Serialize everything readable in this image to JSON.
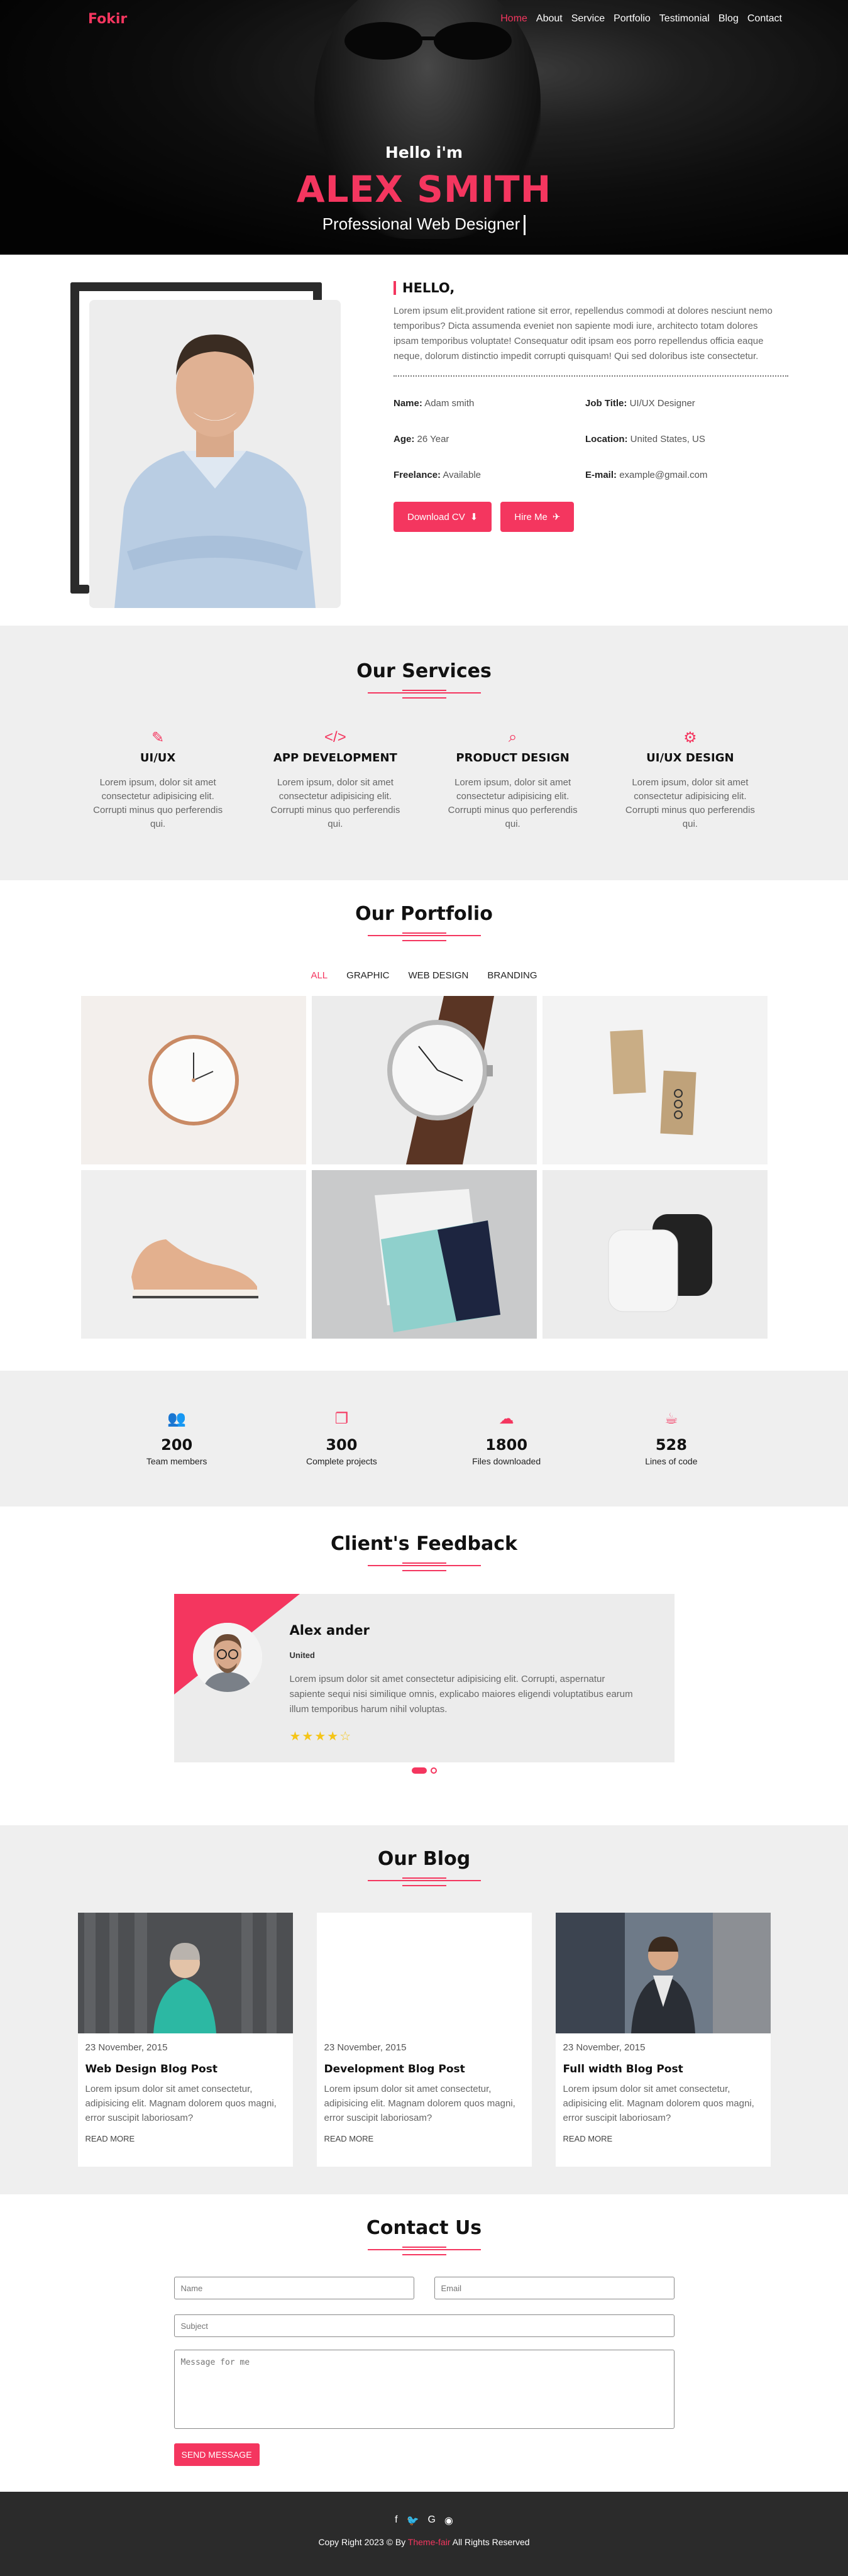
{
  "nav": {
    "logo": "Fokir",
    "items": [
      "Home",
      "About",
      "Service",
      "Portfolio",
      "Testimonial",
      "Blog",
      "Contact"
    ]
  },
  "hero": {
    "greeting": "Hello i'm",
    "name": "ALEX SMITH",
    "role": "Professional Web Designer"
  },
  "about": {
    "title": "HELLO,",
    "text": "Lorem ipsum elit.provident ratione sit error, repellendus commodi at dolores nesciunt nemo temporibus? Dicta assumenda eveniet non sapiente modi iure, architecto totam dolores ipsam temporibus voluptate! Consequatur odit ipsam eos porro repellendus officia eaque neque, dolorum distinctio impedit corrupti quisquam! Qui sed doloribus iste consectetur.",
    "info": [
      {
        "label": "Name:",
        "value": "Adam smith"
      },
      {
        "label": "Job Title:",
        "value": "UI/UX Designer"
      },
      {
        "label": "Age:",
        "value": "26 Year"
      },
      {
        "label": "Location:",
        "value": "United States, US"
      },
      {
        "label": "Freelance:",
        "value": "Available"
      },
      {
        "label": "E-mail:",
        "value": "example@gmail.com"
      }
    ],
    "download_label": "Download CV",
    "hire_label": "Hire Me"
  },
  "services": {
    "title": "Our Services",
    "items": [
      {
        "icon": "magic-wand-icon",
        "title": "UI/UX",
        "text": "Lorem ipsum, dolor sit amet consectetur adipisicing elit. Corrupti minus quo perferendis qui."
      },
      {
        "icon": "code-icon",
        "title": "APP DEVELOPMENT",
        "text": "Lorem ipsum, dolor sit amet consectetur adipisicing elit. Corrupti minus quo perferendis qui."
      },
      {
        "icon": "search-icon",
        "title": "PRODUCT DESIGN",
        "text": "Lorem ipsum, dolor sit amet consectetur adipisicing elit. Corrupti minus quo perferendis qui."
      },
      {
        "icon": "gears-icon",
        "title": "UI/UX DESIGN",
        "text": "Lorem ipsum, dolor sit amet consectetur adipisicing elit. Corrupti minus quo perferendis qui."
      }
    ]
  },
  "portfolio": {
    "title": "Our Portfolio",
    "filters": [
      "ALL",
      "GRAPHIC",
      "WEB DESIGN",
      "BRANDING"
    ]
  },
  "stats": [
    {
      "icon": "users-icon",
      "number": "200",
      "label": "Team members"
    },
    {
      "icon": "copy-icon",
      "number": "300",
      "label": "Complete projects"
    },
    {
      "icon": "cloud-download-icon",
      "number": "1800",
      "label": "Files downloaded"
    },
    {
      "icon": "coffee-icon",
      "number": "528",
      "label": "Lines of code"
    }
  ],
  "feedback": {
    "title": "Client's Feedback",
    "name": "Alex ander",
    "place": "United",
    "text": "Lorem ipsum dolor sit amet consectetur adipisicing elit. Corrupti, aspernatur sapiente sequi nisi similique omnis, explicabo maiores eligendi voluptatibus earum illum temporibus harum nihil voluptas.",
    "rating": 4,
    "stars": "★★★★☆"
  },
  "blog": {
    "title": "Our Blog",
    "posts": [
      {
        "date": "23 November, 2015",
        "title": "Web Design Blog Post",
        "text": "Lorem ipsum dolor sit amet consectetur, adipisicing elit. Magnam dolorem quos magni, error suscipit laboriosam?",
        "more": "READ MORE"
      },
      {
        "date": "23 November, 2015",
        "title": "Development Blog Post",
        "text": "Lorem ipsum dolor sit amet consectetur, adipisicing elit. Magnam dolorem quos magni, error suscipit laboriosam?",
        "more": "READ MORE"
      },
      {
        "date": "23 November, 2015",
        "title": "Full width Blog Post",
        "text": "Lorem ipsum dolor sit amet consectetur, adipisicing elit. Magnam dolorem quos magni, error suscipit laboriosam?",
        "more": "READ MORE"
      }
    ]
  },
  "contact": {
    "title": "Contact Us",
    "name_placeholder": "Name",
    "email_placeholder": "Email",
    "subject_placeholder": "Subject",
    "message_placeholder": "Message for me",
    "send_label": "SEND MESSAGE"
  },
  "footer": {
    "social_icons": [
      "facebook-icon",
      "twitter-icon",
      "google-icon",
      "github-icon"
    ],
    "copy_prefix": "Copy Right 2023 © By ",
    "brand": "Theme-fair",
    "copy_suffix": " All Rights Reserved"
  },
  "colors": {
    "accent": "#f4365f",
    "dark": "#2b2b2b",
    "light_bg": "#efefef"
  }
}
